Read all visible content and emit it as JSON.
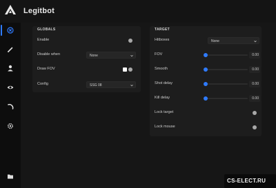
{
  "app": {
    "title": "Legitbot"
  },
  "sidebar": {
    "items": [
      {
        "icon": "crosshair-icon",
        "active": true
      },
      {
        "icon": "pencil-icon",
        "active": false
      },
      {
        "icon": "user-icon",
        "active": false
      },
      {
        "icon": "eye-icon",
        "active": false
      },
      {
        "icon": "loading-arc-icon",
        "active": false
      },
      {
        "icon": "gear-icon",
        "active": false
      },
      {
        "icon": "folder-icon",
        "active": false
      }
    ]
  },
  "globals": {
    "title": "GLOBALS",
    "enable_label": "Enable",
    "disable_when_label": "Disable when",
    "disable_when_value": "None",
    "draw_fov_label": "Draw FOV",
    "config_label": "Config",
    "config_value": "SSG 08"
  },
  "target": {
    "title": "TARGET",
    "hitboxes_label": "Hitboxes",
    "hitboxes_value": "None",
    "fov_label": "FOV",
    "fov_value": "0.00",
    "smooth_label": "Smooth",
    "smooth_value": "0.00",
    "shot_delay_label": "Shot delay",
    "shot_delay_value": "0.00",
    "kill_delay_label": "Kill delay",
    "kill_delay_value": "0.00",
    "lock_target_label": "Lock target",
    "lock_mouse_label": "Lock mouse"
  },
  "watermark": {
    "text": "CS-ELECT.RU"
  },
  "colors": {
    "accent": "#2f7bff",
    "background": "#101010",
    "panel": "#1d1d1d",
    "toggle_off": "#a8a8a8"
  }
}
